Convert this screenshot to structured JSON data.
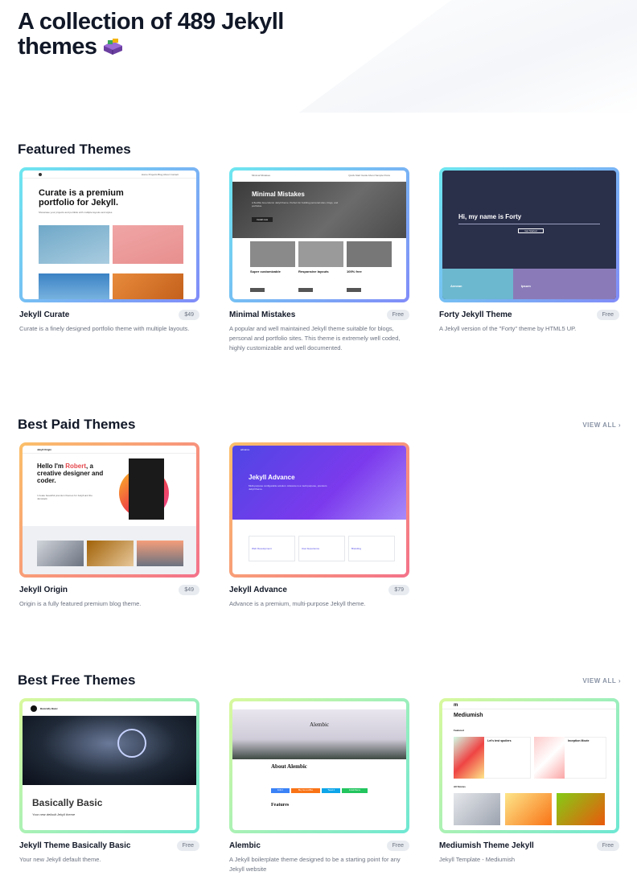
{
  "hero": {
    "title": "A collection of 489 Jekyll themes"
  },
  "sections": {
    "featured": {
      "title": "Featured Themes",
      "themes": [
        {
          "name": "Jekyll Curate",
          "price": "$49",
          "description": "Curate is a finely designed portfolio theme with multiple layouts.",
          "preview": {
            "headline": "Curate is a premium portfolio for Jekyll.",
            "sub": "Showcase your projects and portfolio with multiple layouts and styles."
          }
        },
        {
          "name": "Minimal Mistakes",
          "price": "Free",
          "description": "A popular and well maintained Jekyll theme suitable for blogs, personal and portfolio sites. This theme is extremely well coded, highly customizable and well documented.",
          "preview": {
            "headline": "Minimal Mistakes",
            "sub": "A flexible two-column Jekyll theme. Perfect for building personal sites, blogs, and portfolios.",
            "button": "Install now",
            "features": [
              "Super customizable",
              "Responsive layouts",
              "100% free"
            ]
          }
        },
        {
          "name": "Forty Jekyll Theme",
          "price": "Free",
          "description": "A Jekyll version of the \"Forty\" theme by HTML5 UP.",
          "preview": {
            "headline": "Hi, my name is Forty",
            "button": "Get Started",
            "tiles": [
              "Aenean",
              "Ipsum"
            ]
          }
        }
      ]
    },
    "paid": {
      "title": "Best Paid Themes",
      "view_all": "VIEW ALL",
      "themes": [
        {
          "name": "Jekyll Origin",
          "price": "$49",
          "description": "Origin is a fully featured premium blog theme.",
          "preview": {
            "brand": "Jekyll Origin",
            "headline_pre": "Hello I'm ",
            "headline_name": "Robert",
            "headline_post": ", a creative designer and coder.",
            "sub": "I create beautiful premium themes for Jekyll and the Jamstack."
          }
        },
        {
          "name": "Jekyll Advance",
          "price": "$79",
          "description": "Advance is a premium, multi-purpose Jekyll theme.",
          "preview": {
            "brand": "advance",
            "headline": "Jekyll Advance",
            "sub": "Multi-purpose configurable solution. Advance is a multi purpose, premium Jekyll theme.",
            "services": [
              "Web Development",
              "User Experience",
              "Branding"
            ]
          }
        }
      ]
    },
    "free": {
      "title": "Best Free Themes",
      "view_all": "VIEW ALL",
      "themes": [
        {
          "name": "Jekyll Theme Basically Basic",
          "price": "Free",
          "description": "Your new Jekyll default theme.",
          "preview": {
            "brand": "Basically Basic",
            "headline": "Basically Basic",
            "sub": "Your new default Jekyll theme"
          }
        },
        {
          "name": "Alembic",
          "price": "Free",
          "description": "A Jekyll boilerplate theme designed to be a starting point for any Jekyll website",
          "preview": {
            "headline": "Alembic",
            "about": "About Alembic",
            "features": "Features",
            "buttons": [
              "Fork it",
              "Buy me a coffee",
              "Tweet it",
              "Install theme"
            ]
          }
        },
        {
          "name": "Mediumish Theme Jekyll",
          "price": "Free",
          "description": "Jekyll Template - Mediumish",
          "preview": {
            "headline": "Mediumish",
            "featured": "Featured",
            "all": "All Stories",
            "post1": "Let's test spoilers",
            "post2": "Inception Movie"
          }
        }
      ]
    }
  },
  "colors": {
    "featured_gradient": [
      "#6ee7f0",
      "#818cf8"
    ],
    "paid_gradient": [
      "#fbbf6a",
      "#f4728a"
    ],
    "free_gradient": [
      "#d9f99d",
      "#6ee7d3"
    ]
  }
}
